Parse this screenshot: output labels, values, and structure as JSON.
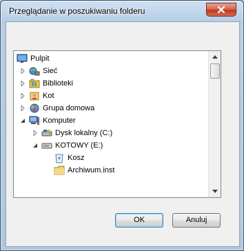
{
  "window": {
    "title": "Przeglądanie w poszukiwaniu folderu"
  },
  "tree": {
    "items": [
      {
        "label": "Pulpit",
        "icon": "desktop-icon",
        "expander": "none",
        "level": 0
      },
      {
        "label": "Sieć",
        "icon": "network-icon",
        "expander": "collapsed",
        "level": 1
      },
      {
        "label": "Biblioteki",
        "icon": "libraries-icon",
        "expander": "collapsed",
        "level": 1
      },
      {
        "label": "Kot",
        "icon": "user-folder-icon",
        "expander": "collapsed",
        "level": 1
      },
      {
        "label": "Grupa domowa",
        "icon": "homegroup-icon",
        "expander": "collapsed",
        "level": 1
      },
      {
        "label": "Komputer",
        "icon": "computer-icon",
        "expander": "expanded",
        "level": 1
      },
      {
        "label": "Dysk lokalny (C:)",
        "icon": "local-disk-icon",
        "expander": "collapsed",
        "level": 2
      },
      {
        "label": "KOTOWY (E:)",
        "icon": "removable-drive-icon",
        "expander": "expanded",
        "level": 2
      },
      {
        "label": "Kosz",
        "icon": "recycle-bin-icon",
        "expander": "none",
        "level": 3
      },
      {
        "label": "Archiwum.inst",
        "icon": "folder-icon",
        "expander": "none",
        "level": 3
      }
    ]
  },
  "buttons": {
    "ok_label": "OK",
    "cancel_label": "Anuluj"
  }
}
